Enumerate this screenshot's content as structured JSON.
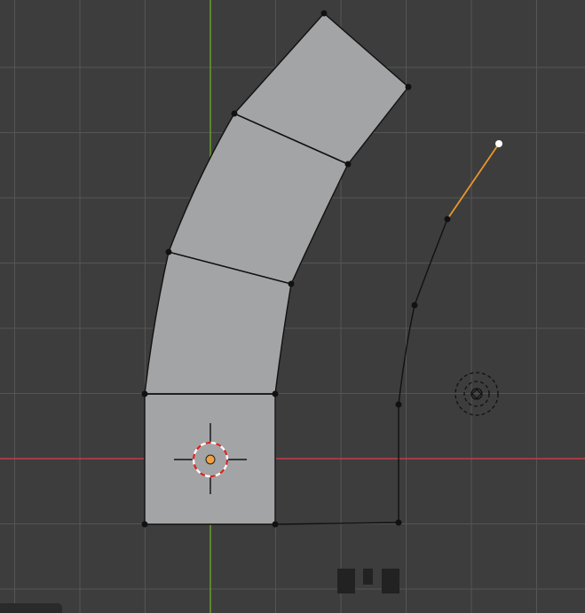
{
  "viewport": {
    "mode": "edit-mode",
    "colors": {
      "background": "#3d3d3d",
      "grid_minor": "#474747",
      "grid_major": "#555555",
      "x_axis": "#c33c49",
      "y_axis": "#6a9b2b",
      "face_fill": "#a3a4a6",
      "edge": "#111111",
      "active_edge": "#e8952e",
      "active_vertex": "#ffffff",
      "origin": "#f0a040",
      "cursor_ring_red": "#d62222",
      "cursor_ring_white": "#ffffff"
    },
    "icons": {
      "cursor": "3d-cursor-icon",
      "origin": "object-origin-icon",
      "light": "light-empty-icon",
      "view_gizmo": "navigation-blocks-icon"
    }
  }
}
